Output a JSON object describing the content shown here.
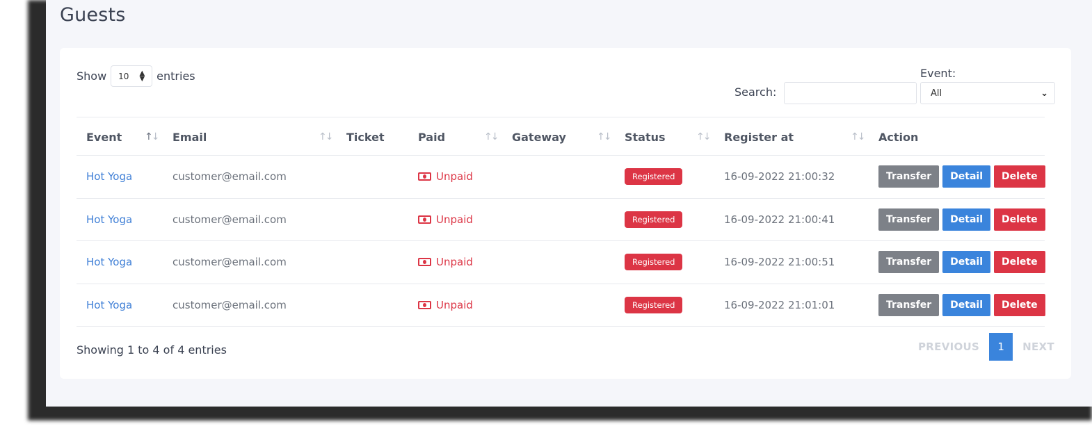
{
  "page": {
    "title": "Guests"
  },
  "controls": {
    "show_label": "Show",
    "length_value": "10",
    "entries_label": "entries",
    "search_label": "Search:",
    "search_value": "",
    "event_label": "Event:",
    "event_selected": "All"
  },
  "table": {
    "headers": [
      "Event",
      "Email",
      "Ticket",
      "Paid",
      "Gateway",
      "Status",
      "Register at",
      "Action"
    ],
    "rows": [
      {
        "event": "Hot Yoga",
        "email": "customer@email.com",
        "ticket": "",
        "paid": "Unpaid",
        "gateway": "",
        "status": "Registered",
        "registered_at": "16-09-2022 21:00:32"
      },
      {
        "event": "Hot Yoga",
        "email": "customer@email.com",
        "ticket": "",
        "paid": "Unpaid",
        "gateway": "",
        "status": "Registered",
        "registered_at": "16-09-2022 21:00:41"
      },
      {
        "event": "Hot Yoga",
        "email": "customer@email.com",
        "ticket": "",
        "paid": "Unpaid",
        "gateway": "",
        "status": "Registered",
        "registered_at": "16-09-2022 21:00:51"
      },
      {
        "event": "Hot Yoga",
        "email": "customer@email.com",
        "ticket": "",
        "paid": "Unpaid",
        "gateway": "",
        "status": "Registered",
        "registered_at": "16-09-2022 21:01:01"
      }
    ],
    "action_labels": {
      "transfer": "Transfer",
      "detail": "Detail",
      "delete": "Delete"
    }
  },
  "footer": {
    "info": "Showing 1 to 4 of 4 entries",
    "previous": "PREVIOUS",
    "current_page": "1",
    "next": "NEXT"
  },
  "colors": {
    "link": "#3f7fd6",
    "danger": "#dc3545",
    "primary": "#3a84dc",
    "secondary": "#7d8188"
  },
  "icons": {
    "paid": "money-bill-icon",
    "sort": "sort-arrows-icon",
    "select": "chevron-down-icon"
  }
}
